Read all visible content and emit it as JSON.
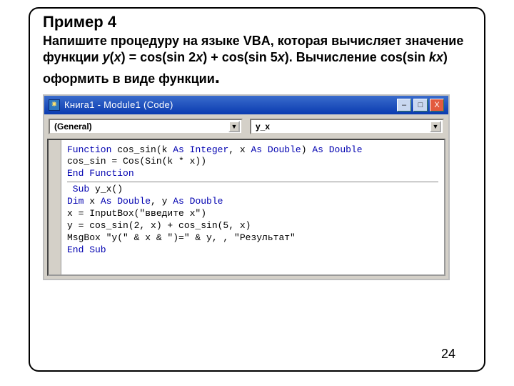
{
  "example": {
    "title": "Пример 4",
    "task_line1": "Напишите процедуру на языке VBA, которая вычисляет значение функции ",
    "task_formula": "y",
    "task_formula2": "(",
    "task_formula3": "x",
    "task_formula4": ") = cos(sin 2",
    "task_formula5": "x",
    "task_formula6": ") + cos(sin 5",
    "task_formula7": "x",
    "task_formula8": "). Вычисление cos(sin ",
    "task_formula9": "kx",
    "task_formula10": ") оформить в виде функции",
    "task_dot": "."
  },
  "ide": {
    "title": "Книга1 - Module1 (Code)",
    "left_dropdown": "(General)",
    "right_dropdown": "y_x",
    "code": {
      "l1a": "Function",
      "l1b": " cos_sin(k ",
      "l1c": "As Integer",
      "l1d": ", x ",
      "l1e": "As Double",
      "l1f": ") ",
      "l1g": "As Double",
      "l2": "cos_sin = Cos(Sin(k * x))",
      "l3": "End Function",
      "l4a": " Sub",
      "l4b": " y_x()",
      "l5a": "Dim",
      "l5b": " x ",
      "l5c": "As Double",
      "l5d": ", y ",
      "l5e": "As Double",
      "l6": "x = InputBox(\"введите x\")",
      "l7": "y = cos_sin(2, x) + cos_sin(5, x)",
      "l8": "MsgBox \"y(\" & x & \")=\" & y, , \"Результат\"",
      "l9": "End Sub"
    }
  },
  "page_number": "24"
}
